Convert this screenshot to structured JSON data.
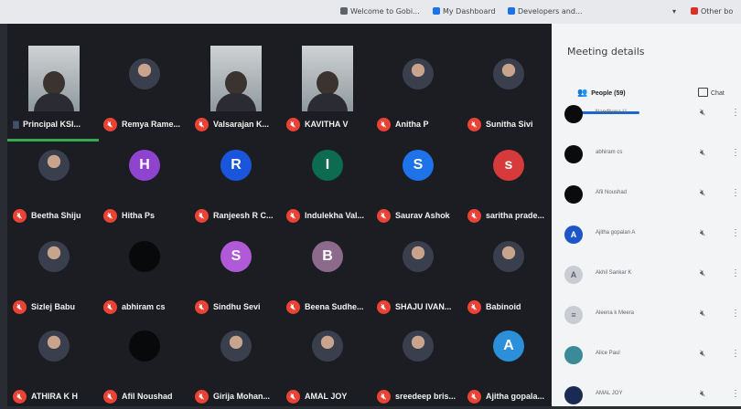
{
  "browser": {
    "bookmarks": [
      "Welcome to Gobi...",
      "My Dashboard",
      "Developers and..."
    ],
    "right_label": "Other bo"
  },
  "grid": {
    "tiles": [
      {
        "name": "Principal KSI...",
        "kind": "video",
        "speaking": true
      },
      {
        "name": "Remya Rame...",
        "kind": "photo"
      },
      {
        "name": "Valsarajan K...",
        "kind": "video"
      },
      {
        "name": "KAVITHA V",
        "kind": "video"
      },
      {
        "name": "Anitha P",
        "kind": "photo"
      },
      {
        "name": "Sunitha Sivi",
        "kind": "photo"
      },
      {
        "name": "Beetha Shiju",
        "kind": "photo"
      },
      {
        "name": "Hitha Ps",
        "kind": "letter",
        "letter": "H",
        "color": "#8e44cf"
      },
      {
        "name": "Ranjeesh R C...",
        "kind": "letter",
        "letter": "R",
        "color": "#1a56db"
      },
      {
        "name": "Indulekha Val...",
        "kind": "letter",
        "letter": "I",
        "color": "#0d6b4f"
      },
      {
        "name": "Saurav Ashok",
        "kind": "letter",
        "letter": "S",
        "color": "#1e73e8"
      },
      {
        "name": "saritha prade...",
        "kind": "letter",
        "letter": "s",
        "color": "#d63a3a"
      },
      {
        "name": "Sizlej Babu",
        "kind": "photo"
      },
      {
        "name": "abhiram cs",
        "kind": "dark"
      },
      {
        "name": "Sindhu Sevi",
        "kind": "letter",
        "letter": "S",
        "color": "#b15ad7"
      },
      {
        "name": "Beena Sudhe...",
        "kind": "letter",
        "letter": "B",
        "color": "#8b6a8b"
      },
      {
        "name": "SHAJU IVAN...",
        "kind": "photo"
      },
      {
        "name": "Babinoid",
        "kind": "photo"
      },
      {
        "name": "ATHIRA K H",
        "kind": "photo"
      },
      {
        "name": "Afil Noushad",
        "kind": "dark"
      },
      {
        "name": "Girija Mohan...",
        "kind": "photo"
      },
      {
        "name": "AMAL JOY",
        "kind": "photo"
      },
      {
        "name": "sreedeep bris...",
        "kind": "photo"
      },
      {
        "name": "Ajitha gopala...",
        "kind": "letter",
        "letter": "A",
        "color": "#2b8fd9"
      }
    ]
  },
  "panel": {
    "title": "Meeting details",
    "people_tab": "People (59)",
    "chat_tab": "Chat",
    "participants": [
      {
        "name": "Nandhana U",
        "avatar": "dark"
      },
      {
        "name": "abhiram cs",
        "avatar": "dark"
      },
      {
        "name": "Afil Noushad",
        "avatar": "dark"
      },
      {
        "name": "Ajitha gopalan A",
        "avatar": "blue",
        "letter": "A"
      },
      {
        "name": "Akhil Sankar K",
        "avatar": "grey",
        "letter": "A"
      },
      {
        "name": "Aleena k Meera",
        "avatar": "grey",
        "letter": "≡"
      },
      {
        "name": "Alice Paul",
        "avatar": "teal",
        "letter": ""
      },
      {
        "name": "AMAL JOY",
        "avatar": "navy",
        "letter": ""
      }
    ]
  }
}
